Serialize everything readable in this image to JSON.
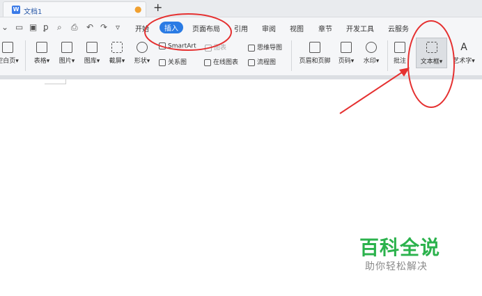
{
  "tab": {
    "title": "文档1"
  },
  "menu": [
    "开始",
    "插入",
    "页面布局",
    "引用",
    "审阅",
    "视图",
    "章节",
    "开发工具",
    "云服务"
  ],
  "ribbon": {
    "blank_page": "空白页",
    "table": "表格",
    "picture": "图片",
    "gallery": "图库",
    "screenshot": "截屏",
    "shape": "形状",
    "smartart": "SmartArt",
    "chart": "图表",
    "relation": "关系图",
    "online_chart": "在线图表",
    "mindmap": "思维导图",
    "flowchart": "流程图",
    "header_footer": "页眉和页脚",
    "page_number": "页码",
    "watermark": "水印",
    "comment": "批注",
    "textbox": "文本框",
    "wordart": "艺术字"
  },
  "watermark": {
    "title": "百科全说",
    "subtitle": "助你轻松解决"
  },
  "colors": {
    "accent": "#2a7be4",
    "annotation": "#e53030",
    "brand": "#2bb24c"
  }
}
